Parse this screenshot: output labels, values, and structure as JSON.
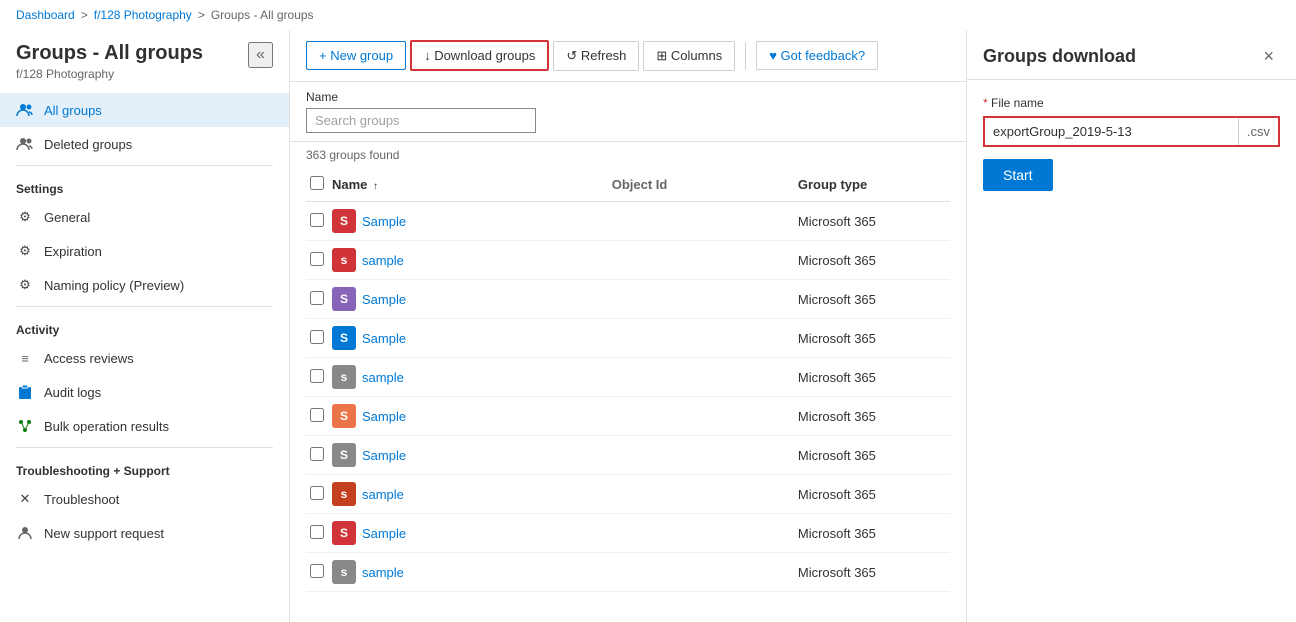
{
  "breadcrumb": {
    "items": [
      "Dashboard",
      "f/128 Photography",
      "Groups - All groups"
    ]
  },
  "sidebar": {
    "title": "Groups - All groups",
    "subtitle": "f/128 Photography",
    "collapse_label": "«",
    "nav": [
      {
        "id": "all-groups",
        "label": "All groups",
        "active": true,
        "icon": "people"
      },
      {
        "id": "deleted-groups",
        "label": "Deleted groups",
        "active": false,
        "icon": "people-delete"
      }
    ],
    "sections": [
      {
        "title": "Settings",
        "items": [
          {
            "id": "general",
            "label": "General",
            "icon": "gear"
          },
          {
            "id": "expiration",
            "label": "Expiration",
            "icon": "gear"
          },
          {
            "id": "naming-policy",
            "label": "Naming policy (Preview)",
            "icon": "gear"
          }
        ]
      },
      {
        "title": "Activity",
        "items": [
          {
            "id": "access-reviews",
            "label": "Access reviews",
            "icon": "list"
          },
          {
            "id": "audit-logs",
            "label": "Audit logs",
            "icon": "clipboard"
          },
          {
            "id": "bulk-operations",
            "label": "Bulk operation results",
            "icon": "tree"
          }
        ]
      },
      {
        "title": "Troubleshooting + Support",
        "items": [
          {
            "id": "troubleshoot",
            "label": "Troubleshoot",
            "icon": "wrench"
          },
          {
            "id": "new-support",
            "label": "New support request",
            "icon": "person-help"
          }
        ]
      }
    ]
  },
  "toolbar": {
    "new_group_label": "+ New group",
    "download_label": "↓ Download groups",
    "refresh_label": "↺ Refresh",
    "columns_label": "⊞ Columns",
    "feedback_label": "♥ Got feedback?"
  },
  "filter": {
    "label": "Name",
    "placeholder": "Search groups"
  },
  "groups_count": "363 groups found",
  "table": {
    "headers": [
      "Name ↑↓",
      "Object Id",
      "Group type"
    ],
    "rows": [
      {
        "name": "Sample",
        "avatar_color": "#d13438",
        "avatar_letter": "S",
        "object_id": "",
        "group_type": "Microsoft 365"
      },
      {
        "name": "sample",
        "avatar_color": "#d13438",
        "avatar_letter": "s",
        "object_id": "",
        "group_type": "Microsoft 365"
      },
      {
        "name": "Sample",
        "avatar_color": "#8764b8",
        "avatar_letter": "S",
        "object_id": "",
        "group_type": "Microsoft 365"
      },
      {
        "name": "Sample",
        "avatar_color": "#0078d4",
        "avatar_letter": "S",
        "object_id": "",
        "group_type": "Microsoft 365"
      },
      {
        "name": "sample",
        "avatar_color": "#8a8886",
        "avatar_letter": "s",
        "object_id": "",
        "group_type": "Microsoft 365"
      },
      {
        "name": "Sample",
        "avatar_color": "#e97548",
        "avatar_letter": "S",
        "object_id": "",
        "group_type": "Microsoft 365"
      },
      {
        "name": "Sample",
        "avatar_color": "#8a8886",
        "avatar_letter": "S",
        "object_id": "",
        "group_type": "Microsoft 365"
      },
      {
        "name": "sample",
        "avatar_color": "#c43f1e",
        "avatar_letter": "s",
        "object_id": "",
        "group_type": "Microsoft 365"
      },
      {
        "name": "Sample",
        "avatar_color": "#d13438",
        "avatar_letter": "S",
        "object_id": "",
        "group_type": "Microsoft 365"
      },
      {
        "name": "sample",
        "avatar_color": "#8a8886",
        "avatar_letter": "s",
        "object_id": "",
        "group_type": "Microsoft 365"
      }
    ]
  },
  "right_panel": {
    "title": "Groups download",
    "close_label": "×",
    "field_label": "* File name",
    "filename_value": "exportGroup_2019-5-13",
    "ext_label": ".csv",
    "start_label": "Start"
  }
}
